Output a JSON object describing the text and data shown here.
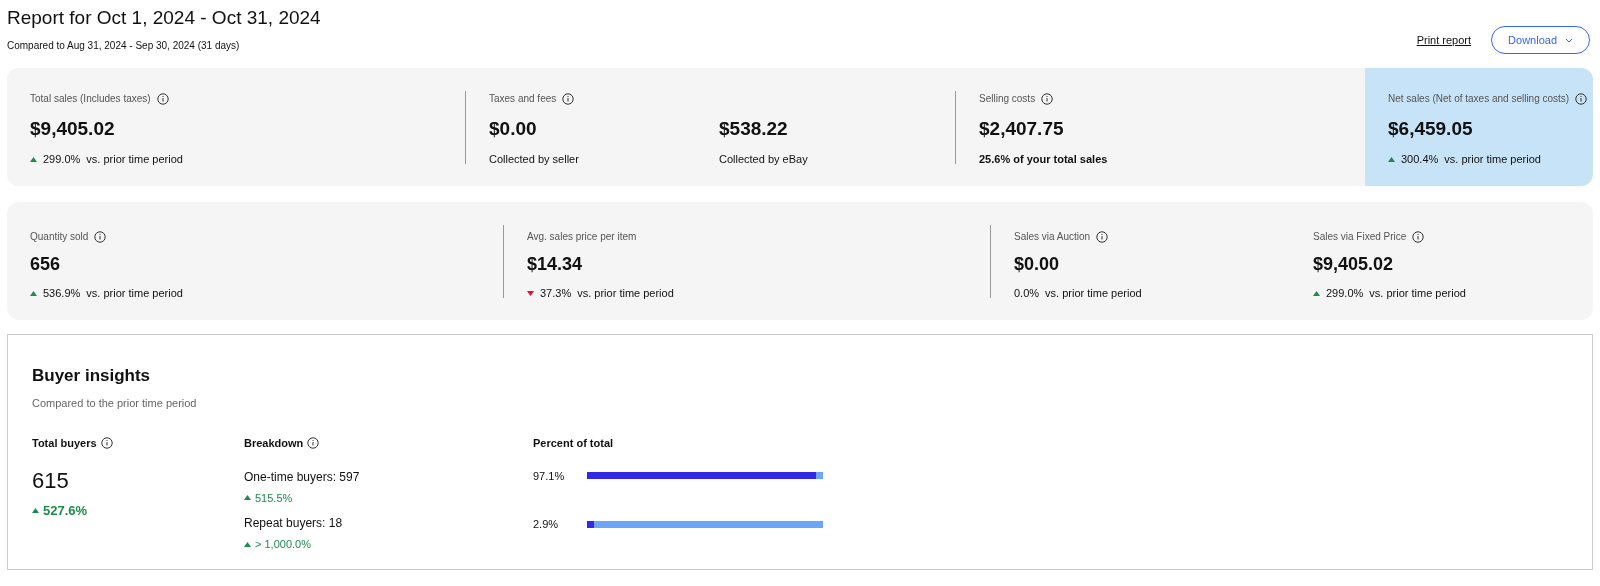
{
  "header": {
    "title": "Report for Oct 1, 2024 - Oct 31, 2024",
    "subtitle": "Compared to Aug 31, 2024 - Sep 30, 2024 (31 days)",
    "print_link": "Print report",
    "download_button": "Download"
  },
  "summary": [
    {
      "label": "Total sales (Includes taxes)",
      "info": true,
      "highlighted": false,
      "values": [
        {
          "value": "$9,405.02",
          "kind": "up",
          "change": "299.0%",
          "note": "vs. prior time period",
          "bold_note": false
        }
      ]
    },
    {
      "label": "Taxes and fees",
      "info": true,
      "highlighted": false,
      "values": [
        {
          "value": "$0.00",
          "note": "Collected by seller",
          "bold_note": false
        },
        {
          "value": "$538.22",
          "note": "Collected by eBay",
          "bold_note": false
        }
      ]
    },
    {
      "label": "Selling costs",
      "info": true,
      "highlighted": false,
      "values": [
        {
          "value": "$2,407.75",
          "note": "25.6% of your total sales",
          "bold_note": true
        }
      ]
    },
    {
      "label": "Net sales (Net of taxes and selling costs)",
      "info": true,
      "highlighted": true,
      "values": [
        {
          "value": "$6,459.05",
          "kind": "up",
          "change": "300.4%",
          "note": "vs. prior time period",
          "bold_note": false
        }
      ]
    }
  ],
  "details": [
    {
      "label": "Quantity sold",
      "info": true,
      "value": "656",
      "kind": "up",
      "change": "536.9%",
      "note": "vs. prior time period"
    },
    {
      "label": "Avg. sales price per item",
      "info": false,
      "value": "$14.34",
      "kind": "down",
      "change": "37.3%",
      "note": "vs. prior time period"
    },
    {
      "label": "Sales via Auction",
      "info": true,
      "value": "$0.00",
      "change": "0.0%",
      "note": "vs. prior time period"
    },
    {
      "label": "Sales via Fixed Price",
      "info": true,
      "value": "$9,405.02",
      "kind": "up",
      "change": "299.0%",
      "note": "vs. prior time period"
    }
  ],
  "buyer_insights": {
    "title": "Buyer insights",
    "subtitle": "Compared to the prior time period",
    "total": {
      "label": "Total buyers",
      "value": "615",
      "change": "527.6%"
    },
    "breakdown": {
      "label": "Breakdown",
      "items": [
        {
          "label": "One-time buyers: 597",
          "change": "515.5%"
        },
        {
          "label": "Repeat buyers: 18",
          "change": "> 1,000.0%"
        }
      ]
    },
    "percent": {
      "label": "Percent of total",
      "rows": [
        {
          "value": "97.1%",
          "level": 0.971
        },
        {
          "value": "2.9%",
          "level": 0.029
        }
      ]
    }
  }
}
